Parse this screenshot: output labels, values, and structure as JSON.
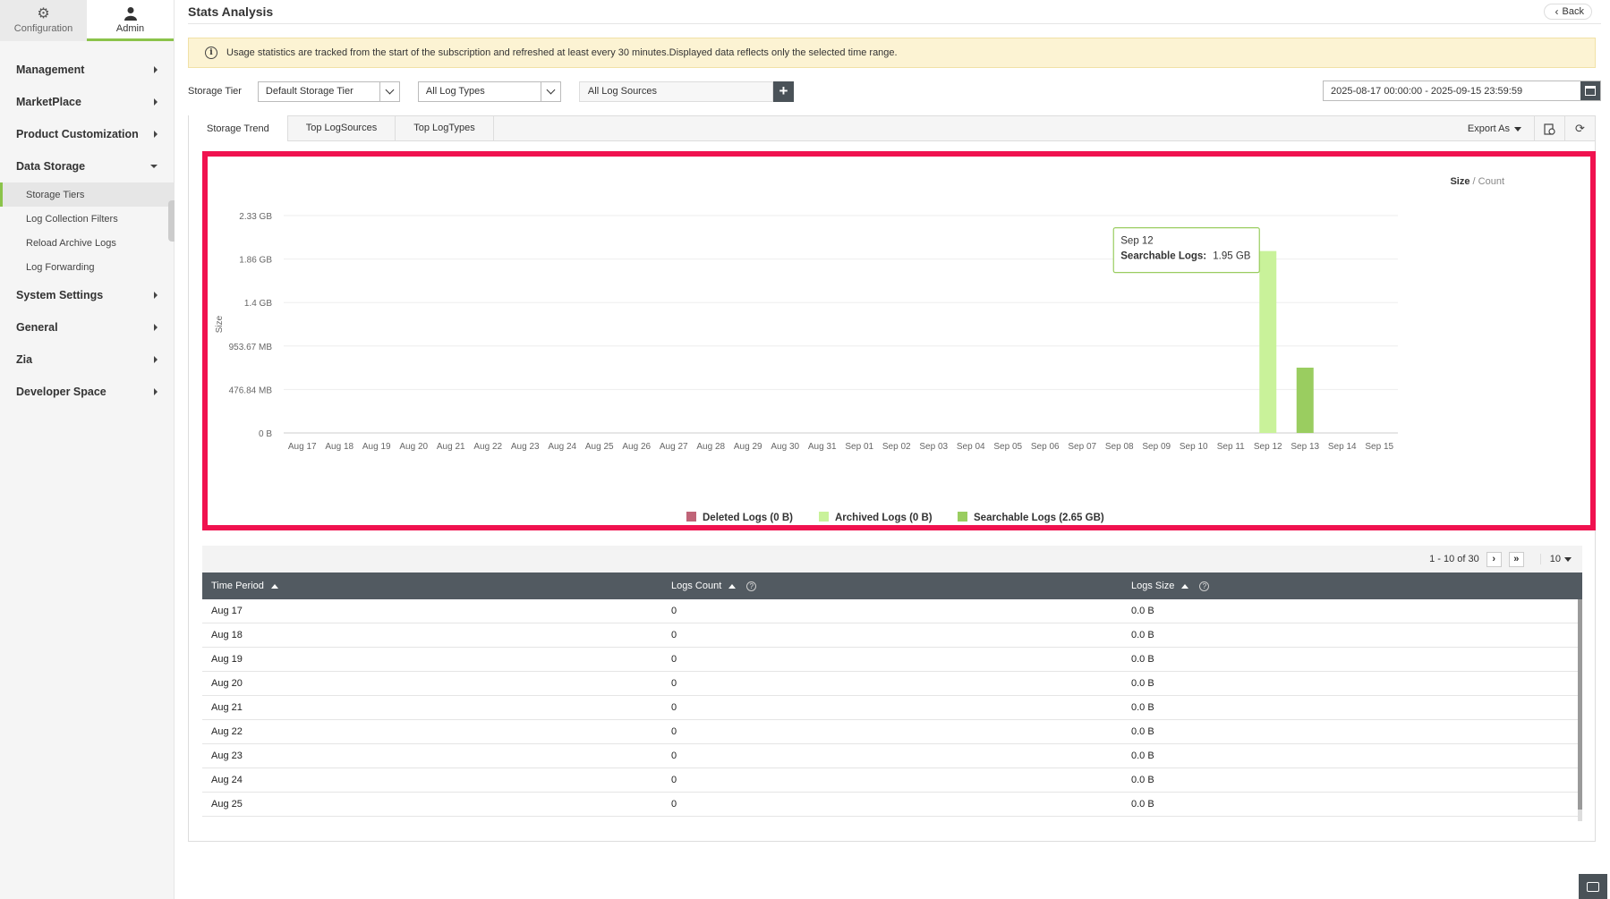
{
  "sidebar": {
    "top_tabs": [
      {
        "label": "Configuration",
        "icon": "gear-icon"
      },
      {
        "label": "Admin",
        "icon": "user-icon"
      }
    ],
    "items": [
      {
        "label": "Management"
      },
      {
        "label": "MarketPlace"
      },
      {
        "label": "Product Customization"
      },
      {
        "label": "Data Storage"
      },
      {
        "label": "System Settings"
      },
      {
        "label": "General"
      },
      {
        "label": "Zia"
      },
      {
        "label": "Developer Space"
      }
    ],
    "sub_items": [
      {
        "label": "Storage Tiers"
      },
      {
        "label": "Log Collection Filters"
      },
      {
        "label": "Reload Archive Logs"
      },
      {
        "label": "Log Forwarding"
      }
    ]
  },
  "header": {
    "title": "Stats Analysis",
    "back_label": "Back"
  },
  "notice": {
    "text": "Usage statistics are tracked from the start of the subscription and refreshed at least every 30 minutes.Displayed data reflects only the selected time range."
  },
  "filters": {
    "storage_tier_label": "Storage Tier",
    "storage_tier_value": "Default Storage Tier",
    "log_types_value": "All Log Types",
    "log_sources_value": "All Log Sources",
    "date_range": "2025-08-17 00:00:00 - 2025-09-15 23:59:59"
  },
  "tabs": [
    {
      "label": "Storage Trend"
    },
    {
      "label": "Top LogSources"
    },
    {
      "label": "Top LogTypes"
    }
  ],
  "tools": {
    "export_label": "Export As"
  },
  "toggle": {
    "size": "Size",
    "sep": " / ",
    "count": "Count"
  },
  "colors": {
    "deleted": "#c06478",
    "archived": "#c9f29a",
    "searchable": "#9acd60",
    "highlight": "#f0124f"
  },
  "chart_data": {
    "type": "bar",
    "ylabel": "Size",
    "y_ticks": [
      "0 B",
      "476.84 MB",
      "953.67 MB",
      "1.4 GB",
      "1.86 GB",
      "2.33 GB"
    ],
    "ylim_gb": [
      0,
      2.33
    ],
    "categories": [
      "Aug 17",
      "Aug 18",
      "Aug 19",
      "Aug 20",
      "Aug 21",
      "Aug 22",
      "Aug 23",
      "Aug 24",
      "Aug 25",
      "Aug 26",
      "Aug 27",
      "Aug 28",
      "Aug 29",
      "Aug 30",
      "Aug 31",
      "Sep 01",
      "Sep 02",
      "Sep 03",
      "Sep 04",
      "Sep 05",
      "Sep 06",
      "Sep 07",
      "Sep 08",
      "Sep 09",
      "Sep 10",
      "Sep 11",
      "Sep 12",
      "Sep 13",
      "Sep 14",
      "Sep 15"
    ],
    "series": [
      {
        "name": "Deleted Logs (0 B)",
        "values": [
          0,
          0,
          0,
          0,
          0,
          0,
          0,
          0,
          0,
          0,
          0,
          0,
          0,
          0,
          0,
          0,
          0,
          0,
          0,
          0,
          0,
          0,
          0,
          0,
          0,
          0,
          0,
          0,
          0,
          0
        ]
      },
      {
        "name": "Archived Logs (0 B)",
        "values": [
          0,
          0,
          0,
          0,
          0,
          0,
          0,
          0,
          0,
          0,
          0,
          0,
          0,
          0,
          0,
          0,
          0,
          0,
          0,
          0,
          0,
          0,
          0,
          0,
          0,
          0,
          0,
          0,
          0,
          0
        ]
      },
      {
        "name": "Searchable Logs (2.65 GB)",
        "values": [
          0,
          0,
          0,
          0,
          0,
          0,
          0,
          0,
          0,
          0,
          0,
          0,
          0,
          0,
          0,
          0,
          0,
          0,
          0,
          0,
          0,
          0,
          0,
          0,
          0,
          0,
          1.95,
          0.7,
          0,
          0
        ]
      }
    ],
    "tooltip": {
      "title": "Sep 12",
      "label": "Searchable Logs:",
      "value": "1.95 GB"
    },
    "highlight_category": "Sep 12",
    "legend_position": "bottom"
  },
  "pager": {
    "range": "1 - 10 of 30",
    "page_size": "10"
  },
  "table": {
    "columns": [
      "Time Period",
      "Logs Count",
      "Logs Size"
    ],
    "rows": [
      [
        "Aug 17",
        "0",
        "0.0 B"
      ],
      [
        "Aug 18",
        "0",
        "0.0 B"
      ],
      [
        "Aug 19",
        "0",
        "0.0 B"
      ],
      [
        "Aug 20",
        "0",
        "0.0 B"
      ],
      [
        "Aug 21",
        "0",
        "0.0 B"
      ],
      [
        "Aug 22",
        "0",
        "0.0 B"
      ],
      [
        "Aug 23",
        "0",
        "0.0 B"
      ],
      [
        "Aug 24",
        "0",
        "0.0 B"
      ],
      [
        "Aug 25",
        "0",
        "0.0 B"
      ]
    ]
  }
}
